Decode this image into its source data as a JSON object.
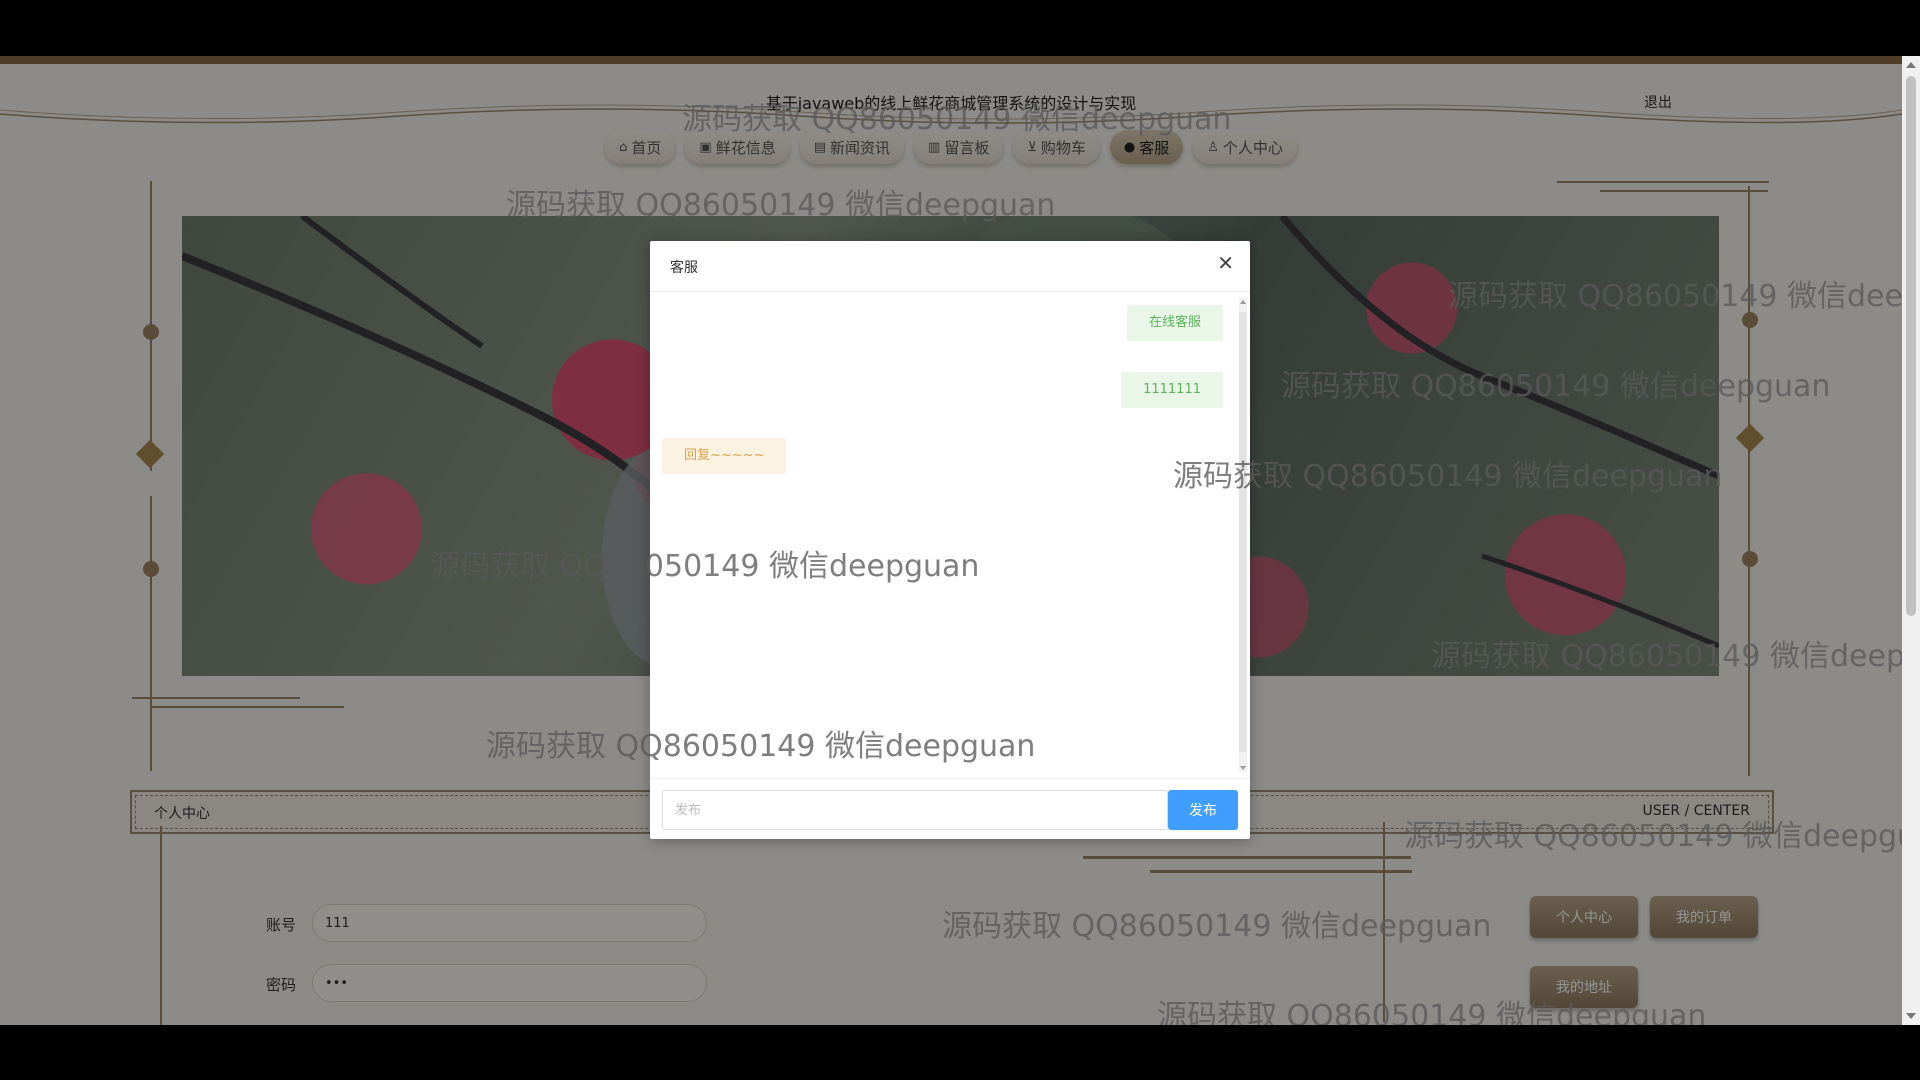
{
  "header": {
    "title": "基于javaweb的线上鲜花商城管理系统的设计与实现",
    "logout": "退出"
  },
  "nav": {
    "items": [
      {
        "label": "首页",
        "icon": "home-icon",
        "glyph": "⌂"
      },
      {
        "label": "鲜花信息",
        "icon": "box-icon",
        "glyph": "▣"
      },
      {
        "label": "新闻资讯",
        "icon": "news-icon",
        "glyph": "▤"
      },
      {
        "label": "留言板",
        "icon": "book-icon",
        "glyph": "▥"
      },
      {
        "label": "购物车",
        "icon": "cart-icon",
        "glyph": "⊻"
      },
      {
        "label": "客服",
        "icon": "chat-icon",
        "glyph": "●"
      },
      {
        "label": "个人中心",
        "icon": "user-icon",
        "glyph": "♙"
      }
    ],
    "active_index": 5
  },
  "section": {
    "left": "个人中心",
    "right": "USER / CENTER"
  },
  "form": {
    "account_label": "账号",
    "account_value": "111",
    "password_label": "密码",
    "password_value": "•••"
  },
  "side_buttons": {
    "profile": "个人中心",
    "orders": "我的订单",
    "address": "我的地址"
  },
  "dialog": {
    "title": "客服",
    "close_glyph": "✕",
    "messages": [
      {
        "from": "me",
        "text": "在线客服"
      },
      {
        "from": "me",
        "text": "1111111"
      },
      {
        "from": "service",
        "text": "回复~~~~~"
      }
    ],
    "input_placeholder": "发布",
    "send_label": "发布"
  },
  "watermark": {
    "text": "源码获取 QQ86050149 微信deepguan"
  },
  "colors": {
    "accent": "#8b6a45",
    "send_button": "#409eff",
    "my_message_bg": "#eaf7e8",
    "my_message_text": "#5ab25a",
    "reply_bg": "#fcf2e2",
    "reply_text": "#d9a34b"
  }
}
